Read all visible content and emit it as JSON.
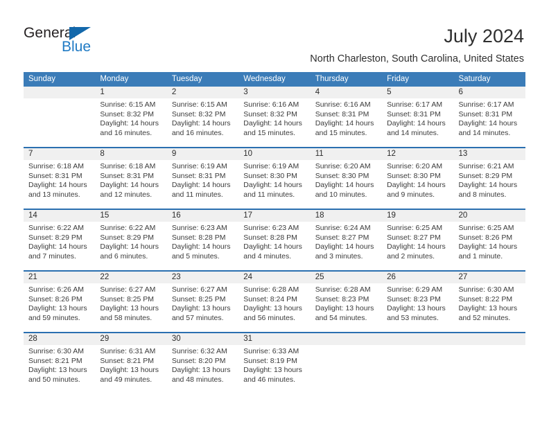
{
  "brand": {
    "name_dark": "General",
    "name_blue": "Blue",
    "blue": "#1f7ac4",
    "triangle_color": "#1368ab"
  },
  "header": {
    "title": "July 2024",
    "subtitle": "North Charleston, South Carolina, United States",
    "header_bg": "#3b7cb8",
    "row_divider": "#2a6fb0",
    "daynum_bg": "#f0f0f0"
  },
  "weekdays": [
    "Sunday",
    "Monday",
    "Tuesday",
    "Wednesday",
    "Thursday",
    "Friday",
    "Saturday"
  ],
  "labels": {
    "sunrise": "Sunrise:",
    "sunset": "Sunset:",
    "daylight": "Daylight:"
  },
  "weeks": [
    {
      "days": [
        {
          "num": "",
          "sunrise": "",
          "sunset": "",
          "daylight_a": "",
          "daylight_b": ""
        },
        {
          "num": "1",
          "sunrise": "Sunrise: 6:15 AM",
          "sunset": "Sunset: 8:32 PM",
          "daylight_a": "Daylight: 14 hours",
          "daylight_b": "and 16 minutes."
        },
        {
          "num": "2",
          "sunrise": "Sunrise: 6:15 AM",
          "sunset": "Sunset: 8:32 PM",
          "daylight_a": "Daylight: 14 hours",
          "daylight_b": "and 16 minutes."
        },
        {
          "num": "3",
          "sunrise": "Sunrise: 6:16 AM",
          "sunset": "Sunset: 8:32 PM",
          "daylight_a": "Daylight: 14 hours",
          "daylight_b": "and 15 minutes."
        },
        {
          "num": "4",
          "sunrise": "Sunrise: 6:16 AM",
          "sunset": "Sunset: 8:31 PM",
          "daylight_a": "Daylight: 14 hours",
          "daylight_b": "and 15 minutes."
        },
        {
          "num": "5",
          "sunrise": "Sunrise: 6:17 AM",
          "sunset": "Sunset: 8:31 PM",
          "daylight_a": "Daylight: 14 hours",
          "daylight_b": "and 14 minutes."
        },
        {
          "num": "6",
          "sunrise": "Sunrise: 6:17 AM",
          "sunset": "Sunset: 8:31 PM",
          "daylight_a": "Daylight: 14 hours",
          "daylight_b": "and 14 minutes."
        }
      ]
    },
    {
      "days": [
        {
          "num": "7",
          "sunrise": "Sunrise: 6:18 AM",
          "sunset": "Sunset: 8:31 PM",
          "daylight_a": "Daylight: 14 hours",
          "daylight_b": "and 13 minutes."
        },
        {
          "num": "8",
          "sunrise": "Sunrise: 6:18 AM",
          "sunset": "Sunset: 8:31 PM",
          "daylight_a": "Daylight: 14 hours",
          "daylight_b": "and 12 minutes."
        },
        {
          "num": "9",
          "sunrise": "Sunrise: 6:19 AM",
          "sunset": "Sunset: 8:31 PM",
          "daylight_a": "Daylight: 14 hours",
          "daylight_b": "and 11 minutes."
        },
        {
          "num": "10",
          "sunrise": "Sunrise: 6:19 AM",
          "sunset": "Sunset: 8:30 PM",
          "daylight_a": "Daylight: 14 hours",
          "daylight_b": "and 11 minutes."
        },
        {
          "num": "11",
          "sunrise": "Sunrise: 6:20 AM",
          "sunset": "Sunset: 8:30 PM",
          "daylight_a": "Daylight: 14 hours",
          "daylight_b": "and 10 minutes."
        },
        {
          "num": "12",
          "sunrise": "Sunrise: 6:20 AM",
          "sunset": "Sunset: 8:30 PM",
          "daylight_a": "Daylight: 14 hours",
          "daylight_b": "and 9 minutes."
        },
        {
          "num": "13",
          "sunrise": "Sunrise: 6:21 AM",
          "sunset": "Sunset: 8:29 PM",
          "daylight_a": "Daylight: 14 hours",
          "daylight_b": "and 8 minutes."
        }
      ]
    },
    {
      "days": [
        {
          "num": "14",
          "sunrise": "Sunrise: 6:22 AM",
          "sunset": "Sunset: 8:29 PM",
          "daylight_a": "Daylight: 14 hours",
          "daylight_b": "and 7 minutes."
        },
        {
          "num": "15",
          "sunrise": "Sunrise: 6:22 AM",
          "sunset": "Sunset: 8:29 PM",
          "daylight_a": "Daylight: 14 hours",
          "daylight_b": "and 6 minutes."
        },
        {
          "num": "16",
          "sunrise": "Sunrise: 6:23 AM",
          "sunset": "Sunset: 8:28 PM",
          "daylight_a": "Daylight: 14 hours",
          "daylight_b": "and 5 minutes."
        },
        {
          "num": "17",
          "sunrise": "Sunrise: 6:23 AM",
          "sunset": "Sunset: 8:28 PM",
          "daylight_a": "Daylight: 14 hours",
          "daylight_b": "and 4 minutes."
        },
        {
          "num": "18",
          "sunrise": "Sunrise: 6:24 AM",
          "sunset": "Sunset: 8:27 PM",
          "daylight_a": "Daylight: 14 hours",
          "daylight_b": "and 3 minutes."
        },
        {
          "num": "19",
          "sunrise": "Sunrise: 6:25 AM",
          "sunset": "Sunset: 8:27 PM",
          "daylight_a": "Daylight: 14 hours",
          "daylight_b": "and 2 minutes."
        },
        {
          "num": "20",
          "sunrise": "Sunrise: 6:25 AM",
          "sunset": "Sunset: 8:26 PM",
          "daylight_a": "Daylight: 14 hours",
          "daylight_b": "and 1 minute."
        }
      ]
    },
    {
      "days": [
        {
          "num": "21",
          "sunrise": "Sunrise: 6:26 AM",
          "sunset": "Sunset: 8:26 PM",
          "daylight_a": "Daylight: 13 hours",
          "daylight_b": "and 59 minutes."
        },
        {
          "num": "22",
          "sunrise": "Sunrise: 6:27 AM",
          "sunset": "Sunset: 8:25 PM",
          "daylight_a": "Daylight: 13 hours",
          "daylight_b": "and 58 minutes."
        },
        {
          "num": "23",
          "sunrise": "Sunrise: 6:27 AM",
          "sunset": "Sunset: 8:25 PM",
          "daylight_a": "Daylight: 13 hours",
          "daylight_b": "and 57 minutes."
        },
        {
          "num": "24",
          "sunrise": "Sunrise: 6:28 AM",
          "sunset": "Sunset: 8:24 PM",
          "daylight_a": "Daylight: 13 hours",
          "daylight_b": "and 56 minutes."
        },
        {
          "num": "25",
          "sunrise": "Sunrise: 6:28 AM",
          "sunset": "Sunset: 8:23 PM",
          "daylight_a": "Daylight: 13 hours",
          "daylight_b": "and 54 minutes."
        },
        {
          "num": "26",
          "sunrise": "Sunrise: 6:29 AM",
          "sunset": "Sunset: 8:23 PM",
          "daylight_a": "Daylight: 13 hours",
          "daylight_b": "and 53 minutes."
        },
        {
          "num": "27",
          "sunrise": "Sunrise: 6:30 AM",
          "sunset": "Sunset: 8:22 PM",
          "daylight_a": "Daylight: 13 hours",
          "daylight_b": "and 52 minutes."
        }
      ]
    },
    {
      "days": [
        {
          "num": "28",
          "sunrise": "Sunrise: 6:30 AM",
          "sunset": "Sunset: 8:21 PM",
          "daylight_a": "Daylight: 13 hours",
          "daylight_b": "and 50 minutes."
        },
        {
          "num": "29",
          "sunrise": "Sunrise: 6:31 AM",
          "sunset": "Sunset: 8:21 PM",
          "daylight_a": "Daylight: 13 hours",
          "daylight_b": "and 49 minutes."
        },
        {
          "num": "30",
          "sunrise": "Sunrise: 6:32 AM",
          "sunset": "Sunset: 8:20 PM",
          "daylight_a": "Daylight: 13 hours",
          "daylight_b": "and 48 minutes."
        },
        {
          "num": "31",
          "sunrise": "Sunrise: 6:33 AM",
          "sunset": "Sunset: 8:19 PM",
          "daylight_a": "Daylight: 13 hours",
          "daylight_b": "and 46 minutes."
        },
        {
          "num": "",
          "sunrise": "",
          "sunset": "",
          "daylight_a": "",
          "daylight_b": ""
        },
        {
          "num": "",
          "sunrise": "",
          "sunset": "",
          "daylight_a": "",
          "daylight_b": ""
        },
        {
          "num": "",
          "sunrise": "",
          "sunset": "",
          "daylight_a": "",
          "daylight_b": ""
        }
      ]
    }
  ]
}
